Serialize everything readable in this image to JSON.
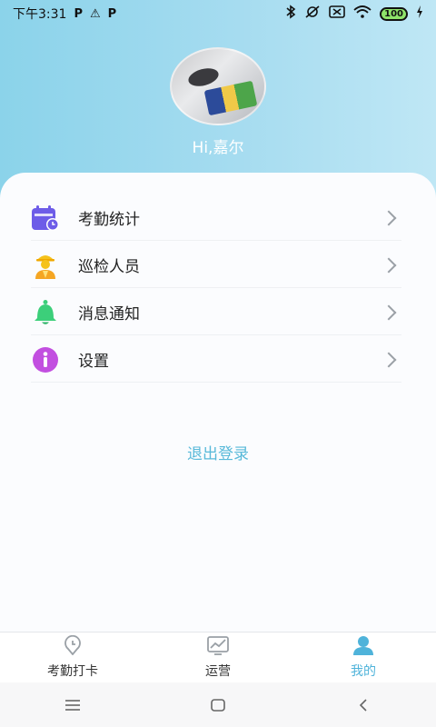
{
  "status_bar": {
    "time": "下午3:31",
    "notification_icons": [
      "P",
      "⚠",
      "P"
    ],
    "battery": "100"
  },
  "profile": {
    "greeting": "Hi,嘉尔"
  },
  "menu": {
    "items": [
      {
        "label": "考勤统计",
        "icon": "calendar-clock-icon"
      },
      {
        "label": " 巡检人员",
        "icon": "inspector-person-icon"
      },
      {
        "label": "消息通知",
        "icon": "bell-icon"
      },
      {
        "label": "设置",
        "icon": "info-icon"
      }
    ]
  },
  "logout_label": "退出登录",
  "tabs": [
    {
      "label": "考勤打卡",
      "icon": "clock-pin-icon",
      "active": false
    },
    {
      "label": "运营",
      "icon": "chart-icon",
      "active": false
    },
    {
      "label": "我的",
      "icon": "person-icon",
      "active": true
    }
  ],
  "colors": {
    "header_gradient_start": "#8bd3ea",
    "accent": "#4fb3da",
    "logout": "#58b9d9"
  }
}
